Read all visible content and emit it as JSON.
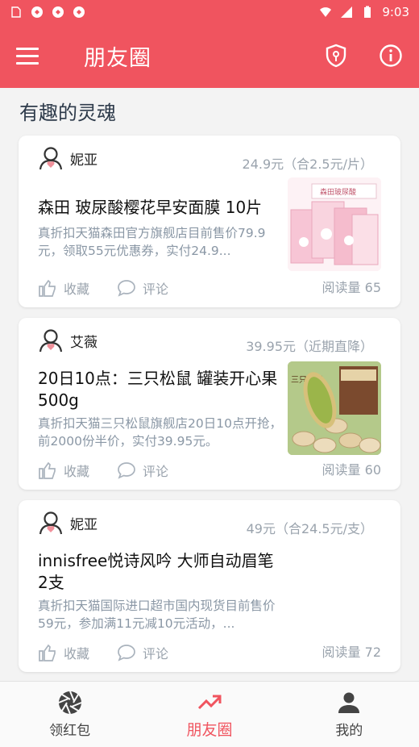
{
  "status_bar": {
    "time": "9:03",
    "icons": [
      "sd-card-icon",
      "app-notification-icon",
      "app-notification-icon",
      "app-notification-icon",
      "wifi-icon",
      "signal-icon",
      "battery-icon"
    ]
  },
  "app_bar": {
    "title": "朋友圈",
    "menu_icon": "menu-icon",
    "shield_icon": "shield-key-icon",
    "info_icon": "info-icon"
  },
  "section": {
    "title": "有趣的灵魂"
  },
  "posts": [
    {
      "author": "妮亚",
      "price": "24.9元（合2.5元/片）",
      "title": "森田 玻尿酸樱花早安面膜 10片",
      "desc": "真折扣天猫森田官方旗舰店目前售价79.9元，领取55元优惠券，实付24.9...",
      "collect_label": "收藏",
      "comment_label": "评论",
      "reads": "阅读量 65",
      "thumb_text": "森田玻尿酸"
    },
    {
      "author": "艾薇",
      "price": "39.95元（近期直降）",
      "title": "20日10点：三只松鼠 罐装开心果 500g",
      "desc": "真折扣天猫三只松鼠旗舰店20日10点开抢，前2000份半价，实付39.95元。",
      "collect_label": "收藏",
      "comment_label": "评论",
      "reads": "阅读量 60",
      "thumb_text": "三只松鼠"
    },
    {
      "author": "妮亚",
      "price": "49元（合24.5元/支）",
      "title": "innisfree悦诗风吟 大师自动眉笔 2支",
      "desc": "真折扣天猫国际进口超市国内现货目前售价59元，参加满11元减10元活动，...",
      "collect_label": "收藏",
      "comment_label": "评论",
      "reads": "阅读量 72"
    }
  ],
  "bottom_nav": [
    {
      "label": "领红包",
      "icon": "aperture-icon",
      "active": false
    },
    {
      "label": "朋友圈",
      "icon": "trending-up-icon",
      "active": true
    },
    {
      "label": "我的",
      "icon": "person-icon",
      "active": false
    }
  ],
  "colors": {
    "primary": "#f0545f",
    "muted_text": "#9aa3ad",
    "desc_text": "#8a97a5",
    "background": "#f3f3f3"
  }
}
